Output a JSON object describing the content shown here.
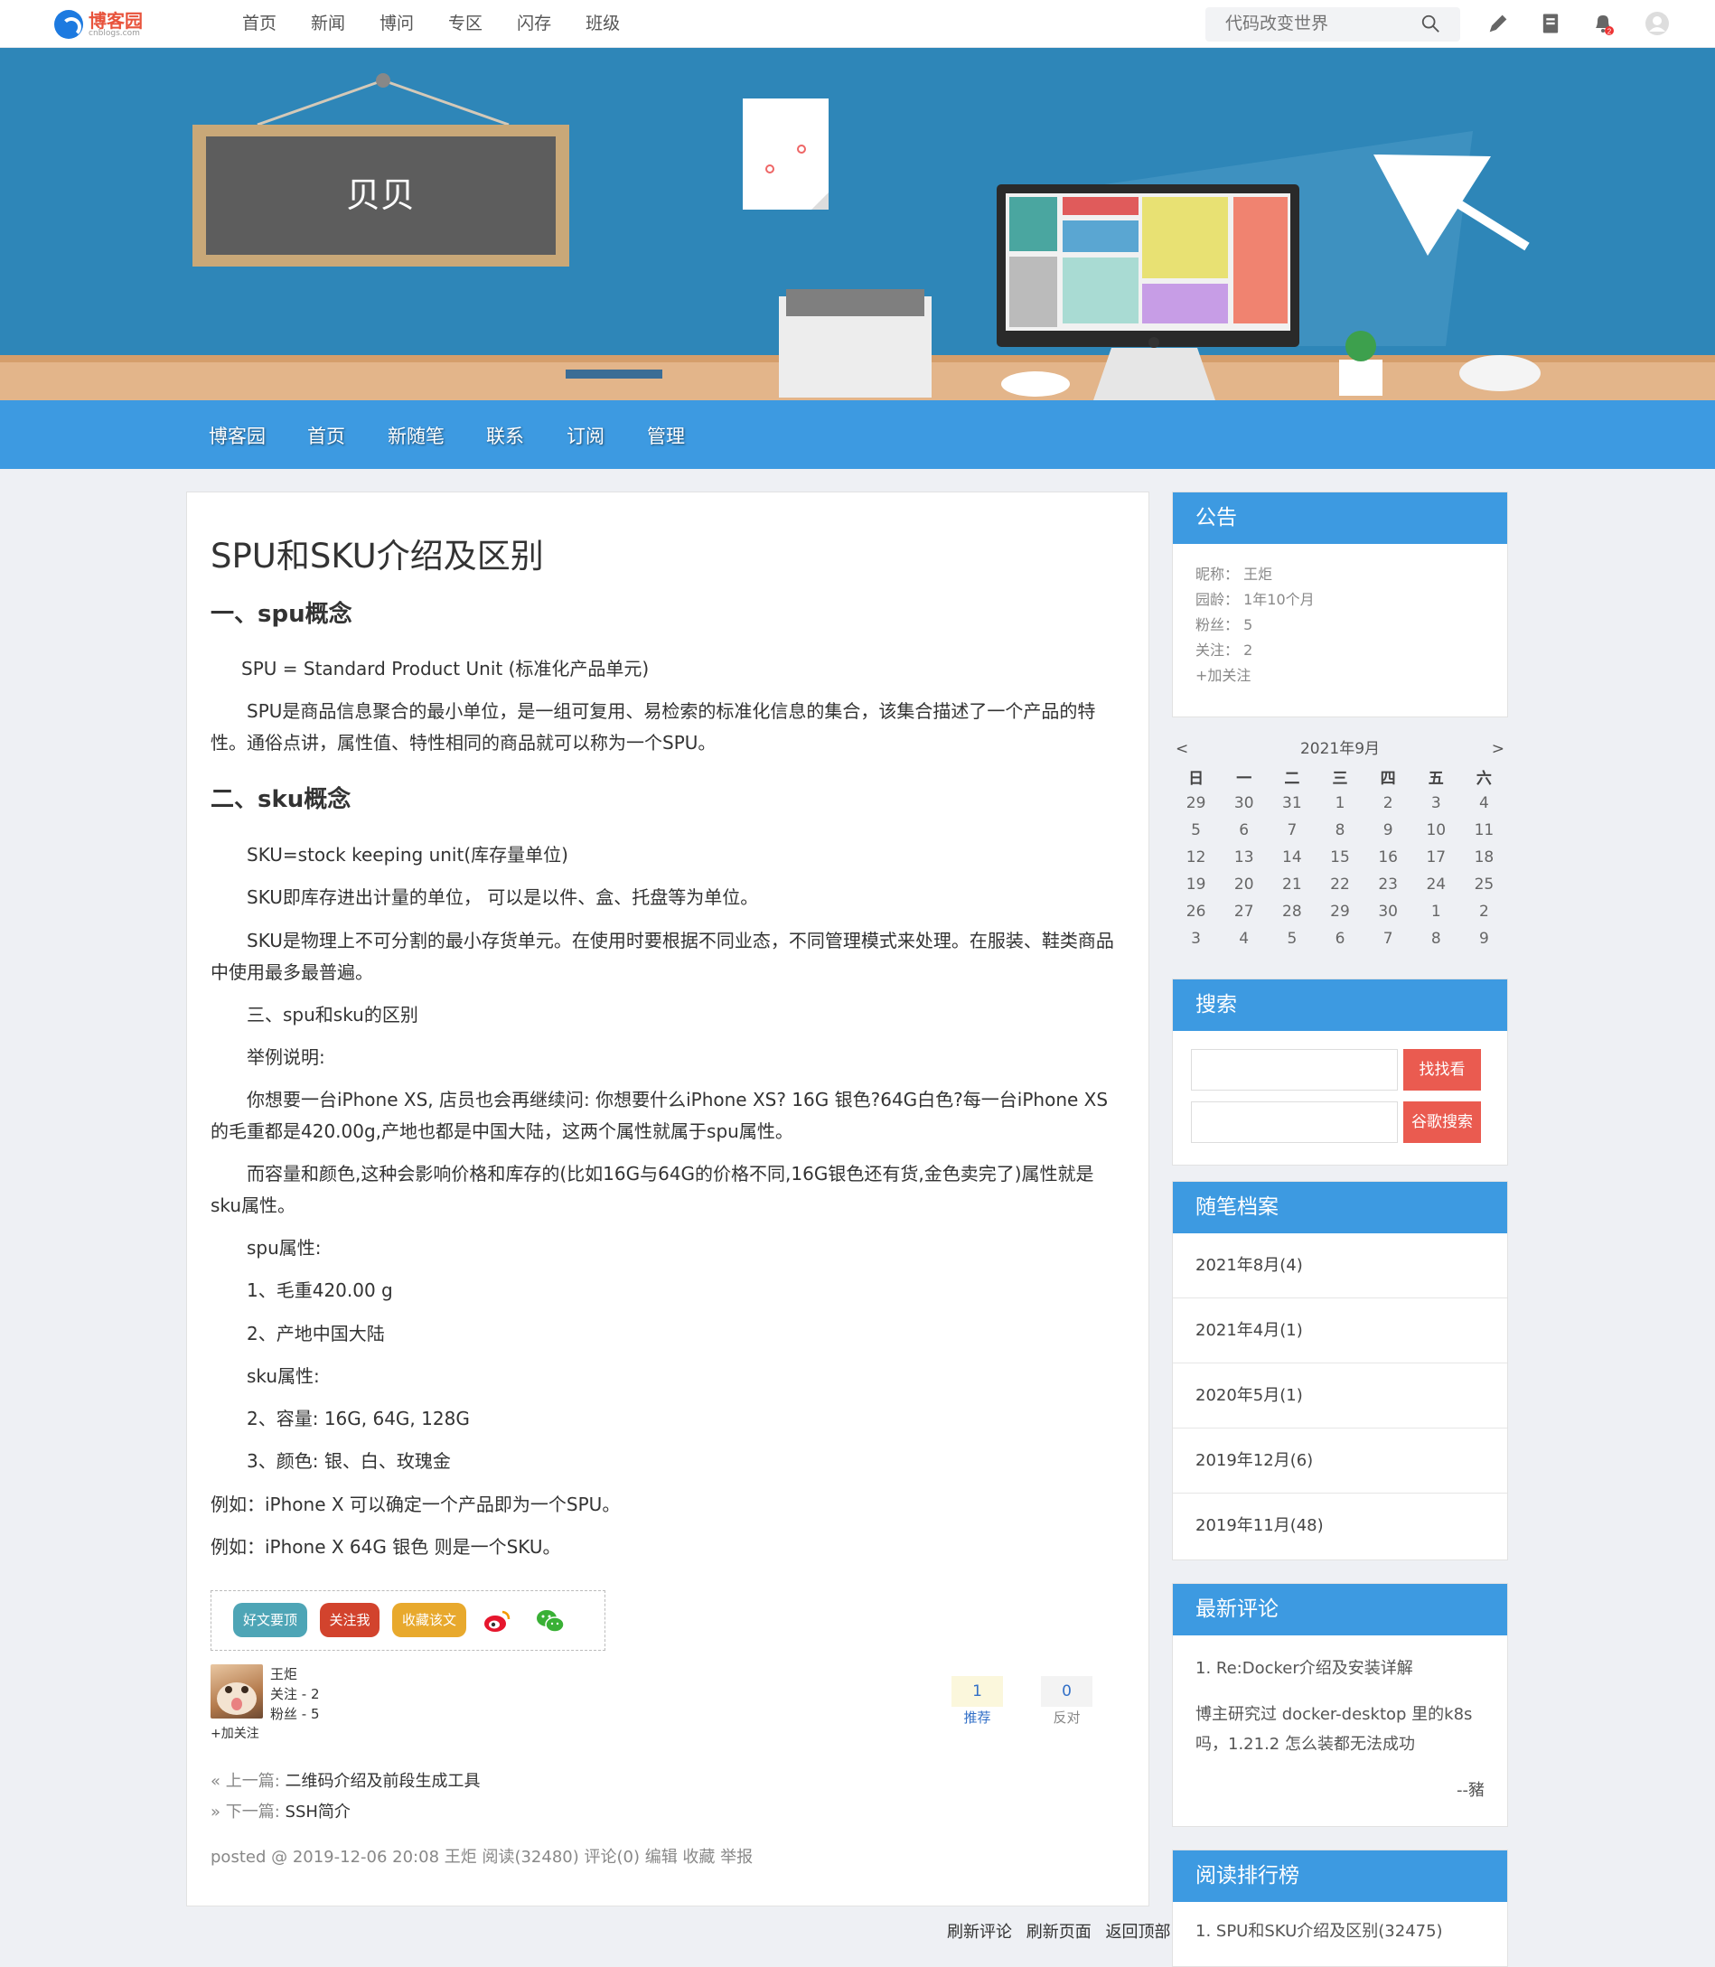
{
  "topbar": {
    "logo_cn": "博客园",
    "logo_en": "cnblogs.com",
    "nav": [
      "首页",
      "新闻",
      "博问",
      "专区",
      "闪存",
      "班级"
    ],
    "search_placeholder": "代码改变世界",
    "notify_count": "2"
  },
  "banner": {
    "board_title": "贝贝",
    "nav": [
      "博客园",
      "首页",
      "新随笔",
      "联系",
      "订阅",
      "管理"
    ]
  },
  "post": {
    "title": "SPU和SKU介绍及区别",
    "h_spu": "一、spu概念",
    "p1": "SPU = Standard Product Unit (标准化产品单元)",
    "p2": "SPU是商品信息聚合的最小单位，是一组可复用、易检索的标准化信息的集合，该集合描述了一个产品的特性。通俗点讲，属性值、特性相同的商品就可以称为一个SPU。",
    "h_sku": "二、sku概念",
    "p3": "SKU=stock keeping unit(库存量单位)",
    "p4": "SKU即库存进出计量的单位， 可以是以件、盒、托盘等为单位。",
    "p5": "SKU是物理上不可分割的最小存货单元。在使用时要根据不同业态，不同管理模式来处理。在服装、鞋类商品中使用最多最普遍。",
    "p6": "三、spu和sku的区别",
    "p7": "举例说明:",
    "p8": "你想要一台iPhone XS, 店员也会再继续问: 你想要什么iPhone XS? 16G 银色?64G白色?每一台iPhone XS的毛重都是420.00g,产地也都是中国大陆，这两个属性就属于spu属性。",
    "p9": "而容量和颜色,这种会影响价格和库存的(比如16G与64G的价格不同,16G银色还有货,金色卖完了)属性就是sku属性。",
    "p10": "spu属性:",
    "p11": "1、毛重420.00 g",
    "p12": "2、产地中国大陆",
    "p13": "sku属性:",
    "p14": "2、容量: 16G, 64G, 128G",
    "p15": "3、颜色: 银、白、玫瑰金",
    "p16": "例如：iPhone X 可以确定一个产品即为一个SPU。",
    "p17": "例如：iPhone X 64G 银色 则是一个SKU。"
  },
  "share": {
    "good": "好文要顶",
    "follow": "关注我",
    "collect": "收藏该文"
  },
  "author": {
    "name": "王炬",
    "following": "关注 - 2",
    "fans": "粉丝 - 5",
    "follow_link": "+加关注"
  },
  "votes": {
    "digg_count": "1",
    "digg_label": "推荐",
    "bury_count": "0",
    "bury_label": "反对"
  },
  "prevnext": {
    "prev_key": "« 上一篇:",
    "prev_title": "二维码介绍及前段生成工具",
    "next_key": "» 下一篇:",
    "next_title": "SSH简介"
  },
  "postinfo": "posted @ 2019-12-06 20:08  王炬  阅读(32480)  评论(0)  编辑  收藏  举报",
  "bottom": [
    "刷新评论",
    "刷新页面",
    "返回顶部"
  ],
  "sidebar": {
    "notice": {
      "title": "公告",
      "lines": [
        "昵称： 王炬",
        "园龄： 1年10个月",
        "粉丝： 5",
        "关注： 2",
        "+加关注"
      ]
    },
    "calendar": {
      "caption": "2021年9月",
      "prev": "<",
      "next": ">",
      "weekdays": [
        "日",
        "一",
        "二",
        "三",
        "四",
        "五",
        "六"
      ],
      "weeks": [
        [
          "29",
          "30",
          "31",
          "1",
          "2",
          "3",
          "4"
        ],
        [
          "5",
          "6",
          "7",
          "8",
          "9",
          "10",
          "11"
        ],
        [
          "12",
          "13",
          "14",
          "15",
          "16",
          "17",
          "18"
        ],
        [
          "19",
          "20",
          "21",
          "22",
          "23",
          "24",
          "25"
        ],
        [
          "26",
          "27",
          "28",
          "29",
          "30",
          "1",
          "2"
        ],
        [
          "3",
          "4",
          "5",
          "6",
          "7",
          "8",
          "9"
        ]
      ]
    },
    "search": {
      "title": "搜索",
      "btn1": "找找看",
      "btn2": "谷歌搜索"
    },
    "archive": {
      "title": "随笔档案",
      "items": [
        "2021年8月(4)",
        "2021年4月(1)",
        "2020年5月(1)",
        "2019年12月(6)",
        "2019年11月(48)"
      ]
    },
    "comments": {
      "title": "最新评论",
      "item_title": "1. Re:Docker介绍及安装详解",
      "item_body": "博主研究过 docker-desktop 里的k8s吗，1.21.2 怎么装都无法成功",
      "item_author": "--豬"
    },
    "rank": {
      "title": "阅读排行榜",
      "first": "1. SPU和SKU介绍及区别(32475)"
    }
  }
}
